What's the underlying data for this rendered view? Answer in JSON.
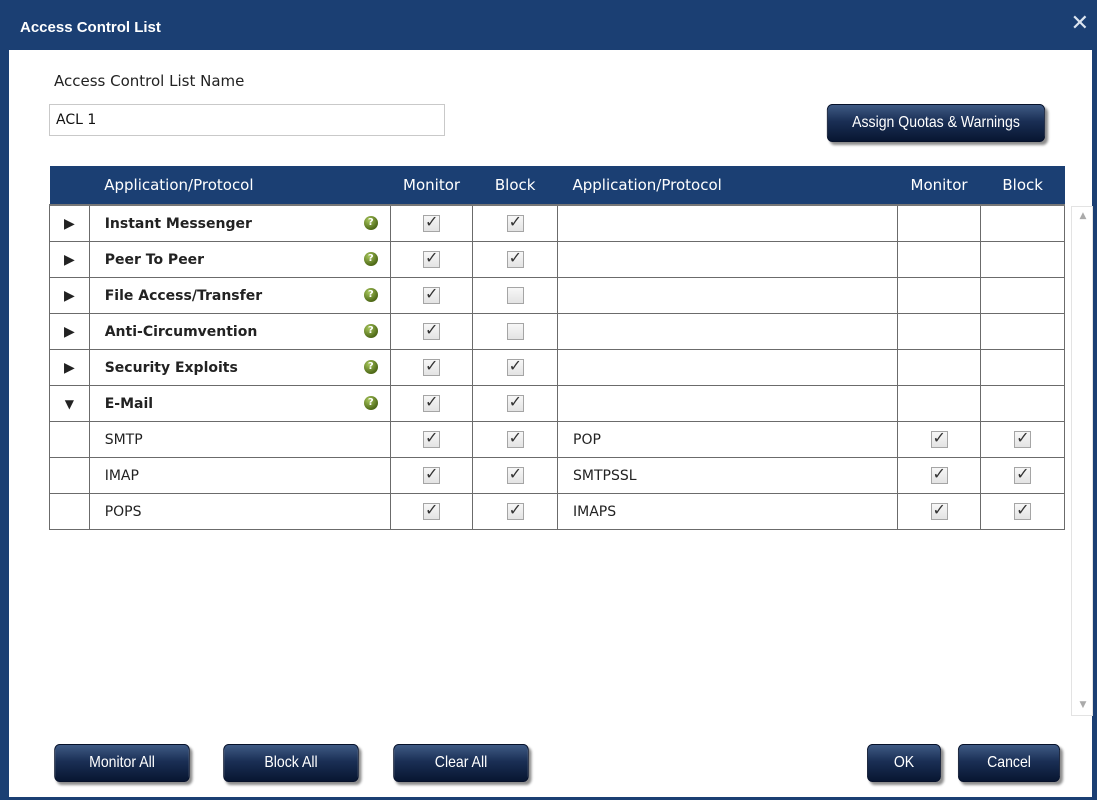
{
  "window": {
    "title": "Access Control List",
    "close_glyph": "✕"
  },
  "acl_name": {
    "label": "Access Control List Name",
    "value": "ACL 1"
  },
  "buttons": {
    "assign": "Assign Quotas & Warnings",
    "monitor_all": "Monitor All",
    "block_all": "Block All",
    "clear_all": "Clear All",
    "ok": "OK",
    "cancel": "Cancel"
  },
  "table": {
    "headers": {
      "app_left": "Application/Protocol",
      "monitor_left": "Monitor",
      "block_left": "Block",
      "app_right": "Application/Protocol",
      "monitor_right": "Monitor",
      "block_right": "Block"
    },
    "categories": [
      {
        "name": "Instant Messenger",
        "expanded": false,
        "monitor": true,
        "block": true
      },
      {
        "name": "Peer To Peer",
        "expanded": false,
        "monitor": true,
        "block": true
      },
      {
        "name": "File Access/Transfer",
        "expanded": false,
        "monitor": true,
        "block": false
      },
      {
        "name": "Anti-Circumvention",
        "expanded": false,
        "monitor": true,
        "block": false
      },
      {
        "name": "Security Exploits",
        "expanded": false,
        "monitor": true,
        "block": true
      },
      {
        "name": "E-Mail",
        "expanded": true,
        "monitor": true,
        "block": true
      }
    ],
    "email_protocols": [
      {
        "left": "SMTP",
        "left_monitor": true,
        "left_block": true,
        "right": "POP",
        "right_monitor": true,
        "right_block": true
      },
      {
        "left": "IMAP",
        "left_monitor": true,
        "left_block": true,
        "right": "SMTPSSL",
        "right_monitor": true,
        "right_block": true
      },
      {
        "left": "POPS",
        "left_monitor": true,
        "left_block": true,
        "right": "IMAPS",
        "right_monitor": true,
        "right_block": true
      }
    ]
  },
  "colors": {
    "title_bar": "#1b3f73",
    "button": "#0f2146",
    "help_icon": "#6a8a1f"
  },
  "icons": {
    "collapsed": "triangle-right-icon",
    "expanded": "triangle-down-icon",
    "help": "question-circle-icon",
    "checkbox": "checkmark-icon"
  }
}
